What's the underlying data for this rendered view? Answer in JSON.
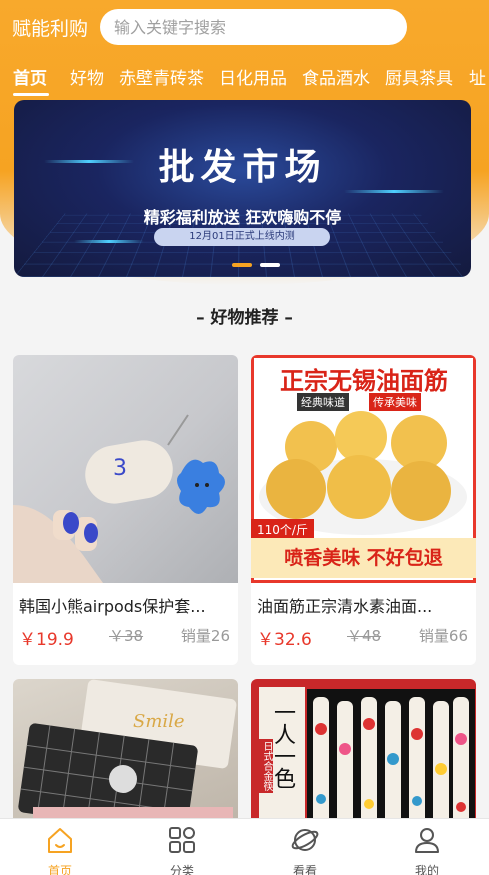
{
  "header": {
    "app_title": "赋能利购",
    "search_placeholder": "输入关键字搜索"
  },
  "tabs": [
    "首页",
    "好物",
    "赤壁青砖茶",
    "日化用品",
    "食品酒水",
    "厨具茶具",
    "址"
  ],
  "banner": {
    "title": "批发市场",
    "subtitle": "精彩福利放送 狂欢嗨购不停",
    "pill": "12月01日正式上线内测"
  },
  "section_title": "– 好物推荐 –",
  "products": [
    {
      "name": "韩国小熊airpods保护套...",
      "price": "￥19.9",
      "old_price": "￥38",
      "sales": "销量26"
    },
    {
      "name": "油面筋正宗清水素油面...",
      "price": "￥32.6",
      "old_price": "￥48",
      "sales": "销量66",
      "image_text": {
        "headline": "正宗无锡油面筋",
        "tag1": "经典味道",
        "tag2": "传承美味",
        "unit": "110个/斤",
        "footer": "喷香美味 不好包退"
      }
    },
    {
      "name": "",
      "image_text": {
        "mat_word": "Smile"
      }
    },
    {
      "name": "",
      "image_text": {
        "vertical": "一人一色",
        "side": "日式合金筷"
      }
    }
  ],
  "bottom_nav": [
    {
      "label": "首页",
      "icon": "home-icon",
      "active": true
    },
    {
      "label": "分类",
      "icon": "category-grid-icon",
      "active": false
    },
    {
      "label": "看看",
      "icon": "planet-icon",
      "active": false
    },
    {
      "label": "我的",
      "icon": "user-icon",
      "active": false
    }
  ],
  "colors": {
    "accent": "#f6a322",
    "price": "#e8382b",
    "banner_bg": "#1a2560"
  }
}
